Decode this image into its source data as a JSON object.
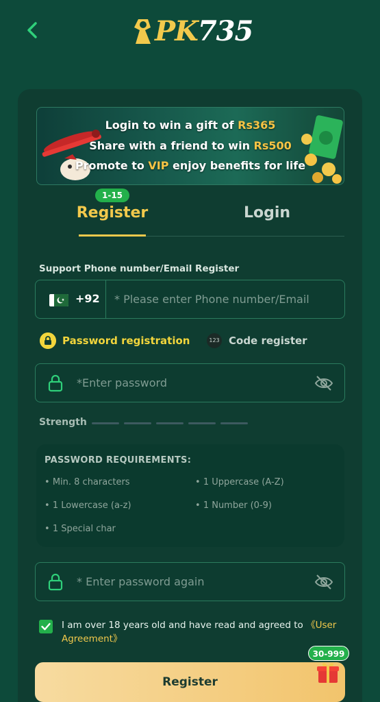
{
  "header": {
    "logo_text_pk": "PK",
    "logo_text_num": "735"
  },
  "banner": {
    "line1_pre": "Login to win a gift of ",
    "line1_amount": "Rs365",
    "line2_pre": "Share with a friend to win ",
    "line2_amount": "Rs500",
    "line3_pre": "Promote to ",
    "line3_vip": "VIP",
    "line3_post": " enjoy benefits for life"
  },
  "tabs": {
    "register_badge": "1-15",
    "register": "Register",
    "login": "Login"
  },
  "form": {
    "support_label": "Support Phone number/Email Register",
    "country_code": "+92",
    "phone_placeholder": "* Please enter Phone number/Email",
    "mode_password": "Password registration",
    "mode_code_icon": "123",
    "mode_code": "Code register",
    "password_placeholder": "*Enter password",
    "strength_label": "Strength",
    "password_again_placeholder": "* Enter password again"
  },
  "requirements": {
    "title": "PASSWORD REQUIREMENTS:",
    "items": [
      "Min. 8 characters",
      "1 Uppercase (A-Z)",
      "1 Lowercase (a-z)",
      "1 Number (0-9)",
      "1 Special char"
    ]
  },
  "agreement": {
    "text": "I am over 18 years old and have read and agreed to ",
    "link": "《User Agreement》",
    "checked": true
  },
  "submit": {
    "label": "Register",
    "bonus_badge": "30-999"
  },
  "icons": {
    "back": "chevron-left-icon",
    "lock": "lock-icon",
    "eye": "eye-off-icon",
    "gift": "gift-icon",
    "flag": "pakistan-flag-icon"
  },
  "colors": {
    "background": "#0d4a3a",
    "accent_gold": "#f2c94c",
    "accent_green": "#23b04b"
  }
}
